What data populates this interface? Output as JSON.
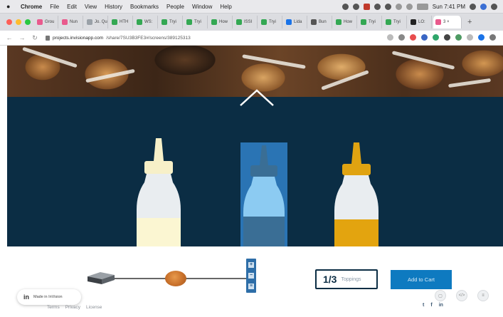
{
  "menubar": {
    "app_name": "Chrome",
    "items": [
      "File",
      "Edit",
      "View",
      "History",
      "Bookmarks",
      "People",
      "Window",
      "Help"
    ],
    "clock": "Sun 7:41 PM"
  },
  "tabs": [
    {
      "label": "Grou",
      "color": "#e95a8d"
    },
    {
      "label": "Nun",
      "color": "#e95a8d"
    },
    {
      "label": "Jo. Que",
      "color": "#9aa1a8"
    },
    {
      "label": "HTH",
      "color": "#34a853"
    },
    {
      "label": "WS:",
      "color": "#34a853"
    },
    {
      "label": "Tryi",
      "color": "#34a853"
    },
    {
      "label": "Tryi",
      "color": "#34a853"
    },
    {
      "label": "How",
      "color": "#34a853"
    },
    {
      "label": "ISSI",
      "color": "#34a853"
    },
    {
      "label": "Tryi",
      "color": "#34a853"
    },
    {
      "label": "Lida",
      "color": "#1a73e8"
    },
    {
      "label": "Bun",
      "color": "#555555"
    },
    {
      "label": "How",
      "color": "#34a853"
    },
    {
      "label": "Tryi",
      "color": "#34a853"
    },
    {
      "label": "Tryi",
      "color": "#34a853"
    },
    {
      "label": "LO:",
      "color": "#222222"
    },
    {
      "label": "3 ×",
      "color": "#e95a8d",
      "active": true
    }
  ],
  "address": {
    "host": "projects.invisionapp.com",
    "path": "/share/7SU3B3FE3#/screens/389125313"
  },
  "colors": {
    "stage": "#0b2d44",
    "highlight": "#2a74b4",
    "accent": "#0e7ac0"
  },
  "hero": {
    "icon": "chevron-up-icon"
  },
  "bottles": [
    {
      "name": "mayonnaise-bottle",
      "cap": "#f7f0c8",
      "fill": "#fbf6d2",
      "body": "#e9edf0",
      "selected": false
    },
    {
      "name": "blue-sauce-bottle",
      "cap": "#3a6e95",
      "fill": "#3a6e95",
      "body": "#8ccbf2",
      "selected": true
    },
    {
      "name": "mustard-bottle",
      "cap": "#e0a311",
      "fill": "#e3a40f",
      "body": "#e9edf0",
      "selected": false
    }
  ],
  "builder": {
    "rail_buttons": [
      "+",
      "−",
      "≡"
    ]
  },
  "counter": {
    "value": "1/3",
    "label": "Toppings"
  },
  "add_to_cart": "Add to Cart",
  "invision_badge": {
    "logo": "in",
    "text": "Made in InVision"
  },
  "footer": {
    "links": [
      "Terms",
      "Privacy",
      "License"
    ]
  },
  "social": [
    "t",
    "f",
    "in"
  ],
  "tools": [
    "comment-icon",
    "code-icon",
    "menu-icon"
  ]
}
